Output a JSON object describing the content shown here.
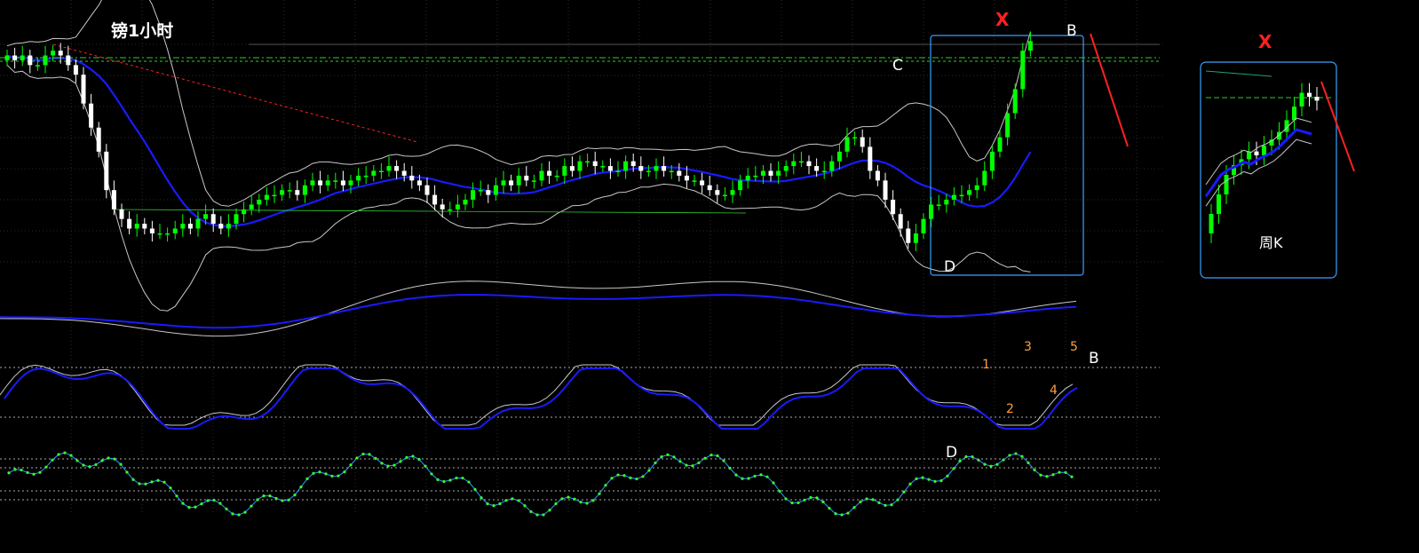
{
  "labels": {
    "main_title": "镑1小时",
    "weekly_title": "周K",
    "x_main": "X",
    "x_weekly": "X",
    "point_c": "C",
    "point_b": "B",
    "point_d": "D",
    "stoch_b": "B",
    "stoch_d": "D",
    "wave_1": "1",
    "wave_2": "2",
    "wave_3": "3",
    "wave_4": "4",
    "wave_5": "5"
  },
  "colors": {
    "background": "#000000",
    "up_candle": "#00ff00",
    "down_candle": "#ffffff",
    "middle_band": "#1a1aff",
    "outer_band": "#c8c8c8",
    "trend_line": "#ff2020",
    "guide_line": "#32cd32",
    "box": "#3aa0ff",
    "wave_numbers": "#ffa040",
    "rsi_line": "#3399ff",
    "rsi_dots": "#33ff33",
    "label_text": "#ffffff",
    "x_mark": "#ff2020"
  },
  "chart_data": [
    {
      "type": "candlestick",
      "panel": "main-1h",
      "title": "镑1小时",
      "indicators": [
        "bollinger-bands",
        "horizontal-levels",
        "trendline"
      ],
      "grid": true,
      "annotations": [
        "C",
        "B",
        "D",
        "X"
      ],
      "close": [
        150,
        149,
        150,
        148,
        148,
        150,
        151,
        150,
        148,
        146,
        140,
        135,
        130,
        122,
        118,
        116,
        114,
        115,
        114,
        113,
        113,
        113,
        114,
        115,
        114,
        116,
        117,
        115,
        114,
        115,
        117,
        118,
        119,
        120,
        121,
        121,
        122,
        122,
        121,
        123,
        124,
        123,
        124,
        124,
        123,
        124,
        125,
        125,
        126,
        126,
        127,
        126,
        125,
        124,
        123,
        121,
        119,
        118,
        118,
        119,
        120,
        122,
        122,
        121,
        123,
        124,
        123,
        125,
        124,
        124,
        126,
        125,
        125,
        127,
        126,
        128,
        128,
        127,
        127,
        126,
        126,
        128,
        127,
        126,
        126,
        127,
        126,
        126,
        125,
        124,
        124,
        123,
        122,
        121,
        121,
        122,
        124,
        125,
        125,
        126,
        125,
        126,
        127,
        128,
        128,
        127,
        126,
        126,
        128,
        130,
        133,
        133,
        131,
        126,
        124,
        120,
        117,
        114,
        111,
        113,
        116,
        119,
        119,
        120,
        121,
        121,
        122,
        123,
        126,
        130,
        133,
        138,
        143,
        151,
        153
      ]
    },
    {
      "type": "line",
      "panel": "oscillator-1",
      "series": [
        {
          "color": "#c8c8c8"
        },
        {
          "color": "#1a1aff"
        }
      ],
      "grid": false
    },
    {
      "type": "line",
      "panel": "stochastic",
      "series": [
        {
          "color": "#c8c8c8"
        },
        {
          "color": "#1a1aff"
        }
      ],
      "reference_levels": [
        "overbought",
        "oversold"
      ],
      "annotations": [
        "1",
        "2",
        "3",
        "4",
        "5",
        "B",
        "D"
      ]
    },
    {
      "type": "line",
      "panel": "rsi",
      "series": [
        {
          "color": "#3399ff",
          "markers": "dots"
        }
      ],
      "reference_levels": [
        "upper",
        "middle",
        "lower"
      ]
    },
    {
      "type": "candlestick",
      "panel": "weekly",
      "title": "周K",
      "close": [
        20,
        30,
        40,
        45,
        48,
        52,
        50,
        55,
        58,
        62,
        68,
        75,
        82,
        80,
        78
      ]
    }
  ]
}
